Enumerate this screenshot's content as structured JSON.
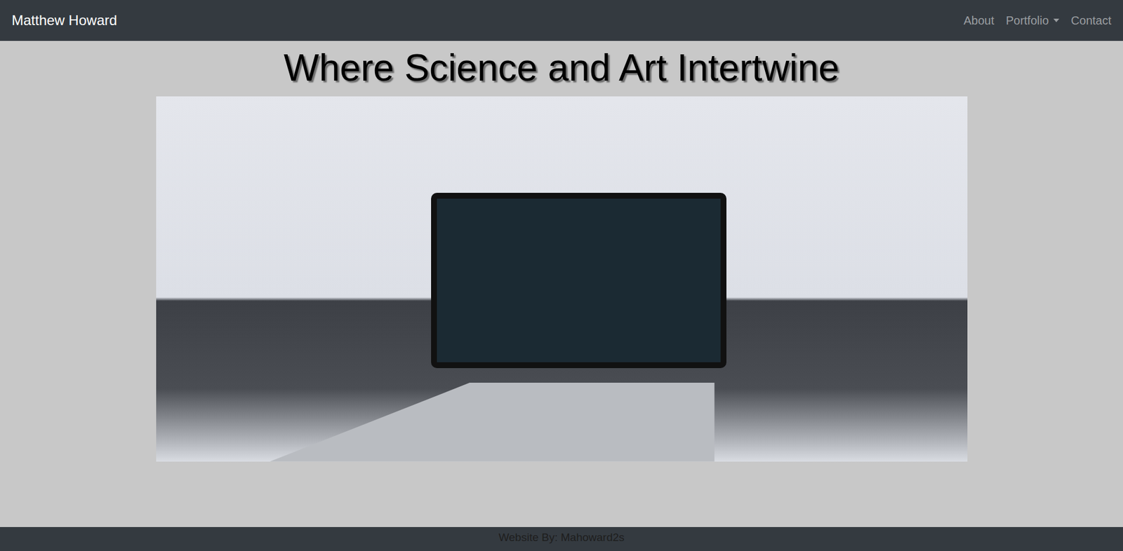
{
  "navbar": {
    "brand": "Matthew Howard",
    "links": [
      {
        "label": "About",
        "kind": "link"
      },
      {
        "label": "Portfolio",
        "kind": "dropdown"
      },
      {
        "label": "Contact",
        "kind": "link"
      }
    ]
  },
  "hero": {
    "title": "Where Science and Art Intertwine"
  },
  "footer": {
    "text": "Website By: Mahoward2s"
  }
}
